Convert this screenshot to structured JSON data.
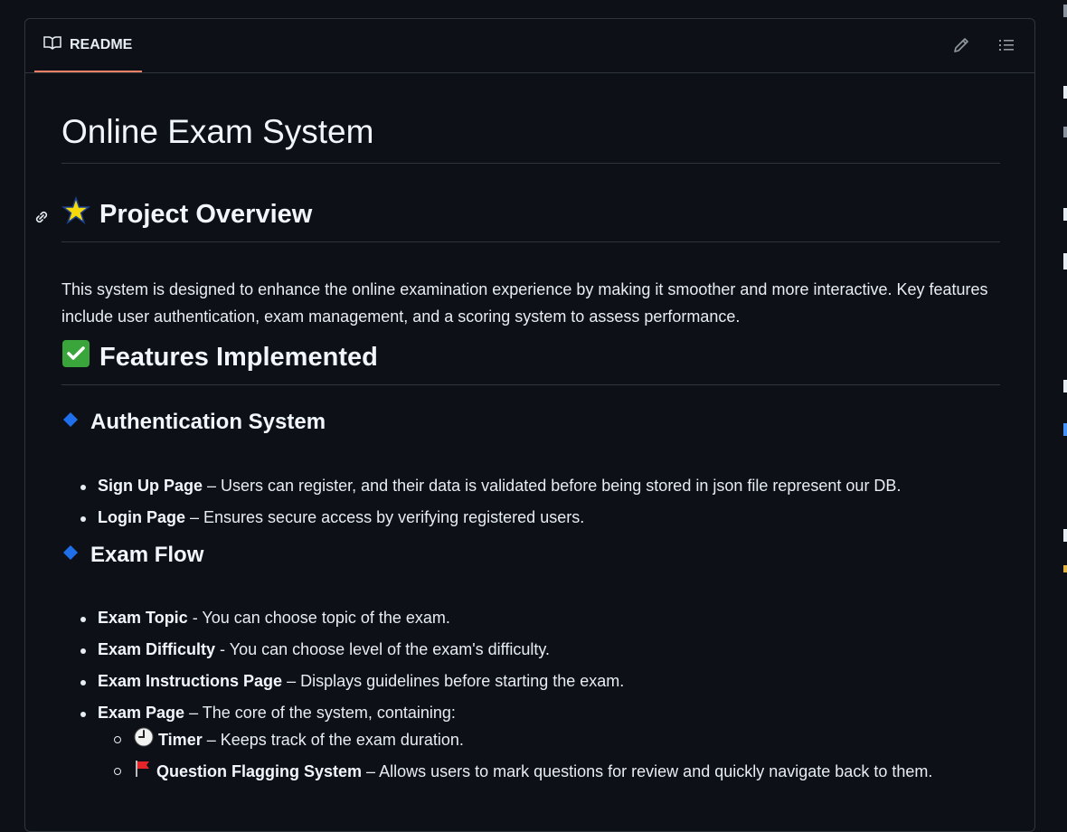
{
  "tab": {
    "label": "README"
  },
  "header_actions": {
    "edit_icon": "pencil-icon",
    "toc_icon": "list-icon"
  },
  "title": "Online Exam System",
  "overview": {
    "heading": "Project Overview",
    "icon": "star-icon",
    "text": "This system is designed to enhance the online examination experience by making it smoother and more interactive. Key features include user authentication, exam management, and a scoring system to assess performance."
  },
  "features": {
    "heading": "Features Implemented",
    "icon": "check-mark-icon"
  },
  "auth": {
    "heading": "Authentication System",
    "items": [
      {
        "bold": "Sign Up Page",
        "text": " – Users can register, and their data is validated before being stored in json file represent our DB."
      },
      {
        "bold": "Login Page",
        "text": " – Ensures secure access by verifying registered users."
      }
    ]
  },
  "exam_flow": {
    "heading": "Exam Flow",
    "items": [
      {
        "bold": "Exam Topic",
        "text": " - You can choose topic of the exam."
      },
      {
        "bold": "Exam Difficulty",
        "text": " - You can choose level of the exam's difficulty."
      },
      {
        "bold": "Exam Instructions Page",
        "text": " – Displays guidelines before starting the exam."
      },
      {
        "bold": "Exam Page",
        "text": " – The core of the system, containing:"
      }
    ],
    "sub_items": [
      {
        "icon": "clock-icon",
        "bold": "Timer",
        "text": " – Keeps track of the exam duration."
      },
      {
        "icon": "red-flag-icon",
        "bold": "Question Flagging System",
        "text": " – Allows users to mark questions for review and quickly navigate back to them."
      }
    ]
  },
  "colors": {
    "accent_tab": "#f78166",
    "background": "#0d1117",
    "border": "#30363d",
    "diamond": "#1f6feb"
  }
}
